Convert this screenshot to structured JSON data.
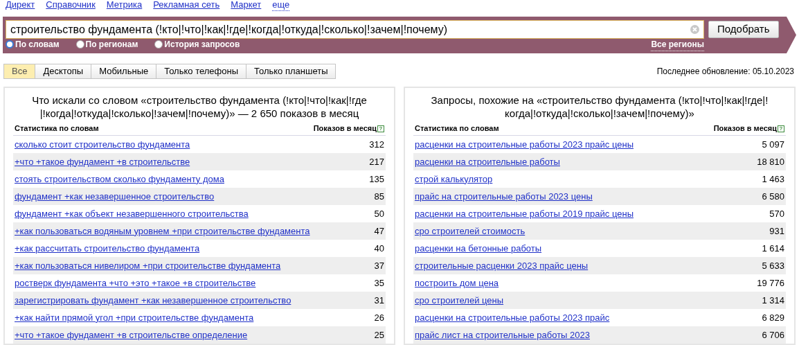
{
  "top_nav": [
    "Директ",
    "Справочник",
    "Метрика",
    "Рекламная сеть",
    "Маркет"
  ],
  "top_nav_more": "еще",
  "search": {
    "value": "строительство фундамента (!кто|!что|!как|!где|!когда|!откуда|!сколько|!зачем|!почему)",
    "button": "Подобрать",
    "all_regions": "Все регионы"
  },
  "modes": [
    {
      "label": "По словам",
      "selected": true
    },
    {
      "label": "По регионам",
      "selected": false
    },
    {
      "label": "История запросов",
      "selected": false
    }
  ],
  "tabs": [
    {
      "label": "Все",
      "selected": true
    },
    {
      "label": "Десктопы",
      "selected": false
    },
    {
      "label": "Мобильные",
      "selected": false
    },
    {
      "label": "Только телефоны",
      "selected": false
    },
    {
      "label": "Только планшеты",
      "selected": false
    }
  ],
  "last_update": "Последнее обновление: 05.10.2023",
  "panels": [
    {
      "title": "Что искали со словом «строительство фундамента (!кто|!что|!как|!где|!когда|!откуда|!сколько|!зачем|!почему)» — 2 650 показов в месяц",
      "columns": [
        "Статистика по словам",
        "Показов в месяц"
      ],
      "help": "?",
      "rows": [
        {
          "phrase": "сколько стоит строительство фундамента",
          "count": "312"
        },
        {
          "phrase": "+что +такое фундамент +в строительстве",
          "count": "217"
        },
        {
          "phrase": "стоять строительством сколько фундаменту дома",
          "count": "135"
        },
        {
          "phrase": "фундамент +как незавершенное строительство",
          "count": "85"
        },
        {
          "phrase": "фундамент +как объект незавершенного строительства",
          "count": "50"
        },
        {
          "phrase": "+как пользоваться водяным уровнем +при строительстве фундамента",
          "count": "47"
        },
        {
          "phrase": "+как рассчитать строительство фундамента",
          "count": "40"
        },
        {
          "phrase": "+как пользоваться нивелиром +при строительстве фундамента",
          "count": "37"
        },
        {
          "phrase": "ростверк фундамента +что +это +такое +в строительстве",
          "count": "35"
        },
        {
          "phrase": "зарегистрировать фундамент +как незавершенное строительство",
          "count": "31"
        },
        {
          "phrase": "+как найти прямой угол +при строительстве фундамента",
          "count": "26"
        },
        {
          "phrase": "+что +такое фундамент +в строительстве определение",
          "count": "25"
        }
      ]
    },
    {
      "title": "Запросы, похожие на «строительство фундамента (!кто|!что|!как|!где|!когда|!откуда|!сколько|!зачем|!почему)»",
      "columns": [
        "Статистика по словам",
        "Показов в месяц"
      ],
      "help": "?",
      "rows": [
        {
          "phrase": "расценки на строительные работы 2023 прайс цены",
          "count": "5 097"
        },
        {
          "phrase": "расценки на строительные работы",
          "count": "18 810"
        },
        {
          "phrase": "строй калькулятор",
          "count": "1 463"
        },
        {
          "phrase": "прайс на строительные работы 2023 цены",
          "count": "6 580"
        },
        {
          "phrase": "расценки на строительные работы 2019 прайс цены",
          "count": "570"
        },
        {
          "phrase": "сро строителей стоимость",
          "count": "931"
        },
        {
          "phrase": "расценки на бетонные работы",
          "count": "1 614"
        },
        {
          "phrase": "строительные расценки 2023 прайс цены",
          "count": "5 633"
        },
        {
          "phrase": "построить дом цена",
          "count": "19 776"
        },
        {
          "phrase": "сро строителей цены",
          "count": "1 314"
        },
        {
          "phrase": "расценки на строительные работы 2023 прайс",
          "count": "6 829"
        },
        {
          "phrase": "прайс лист на строительные работы 2023",
          "count": "6 706"
        }
      ]
    }
  ]
}
